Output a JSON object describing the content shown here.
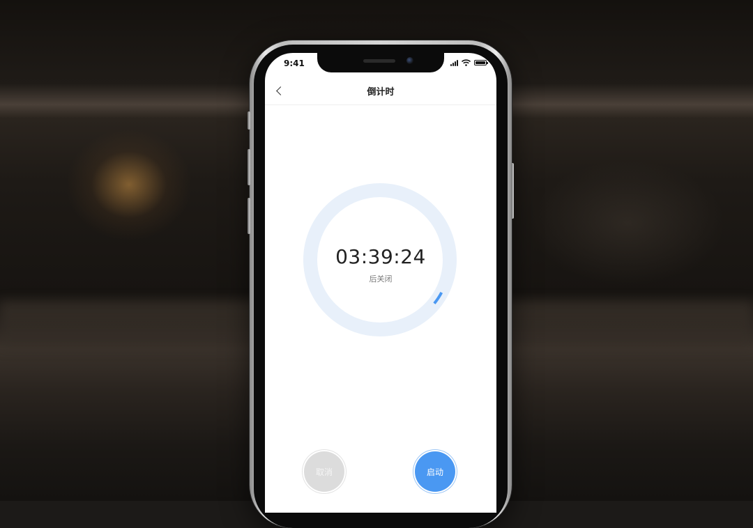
{
  "status_bar": {
    "time": "9:41",
    "icons": [
      "signal-icon",
      "wifi-icon",
      "battery-icon"
    ]
  },
  "nav": {
    "back_icon": "chevron-left-icon",
    "title": "倒计时"
  },
  "timer": {
    "remaining": "03:39:24",
    "caption": "后关闭",
    "progress_fraction": 0.03,
    "ring_track_color": "#e8f0fa",
    "ring_progress_color": "#4a98f2"
  },
  "buttons": {
    "cancel_label": "取消",
    "start_label": "启动"
  },
  "colors": {
    "accent": "#4a98f2",
    "disabled": "#dcdcdc"
  }
}
